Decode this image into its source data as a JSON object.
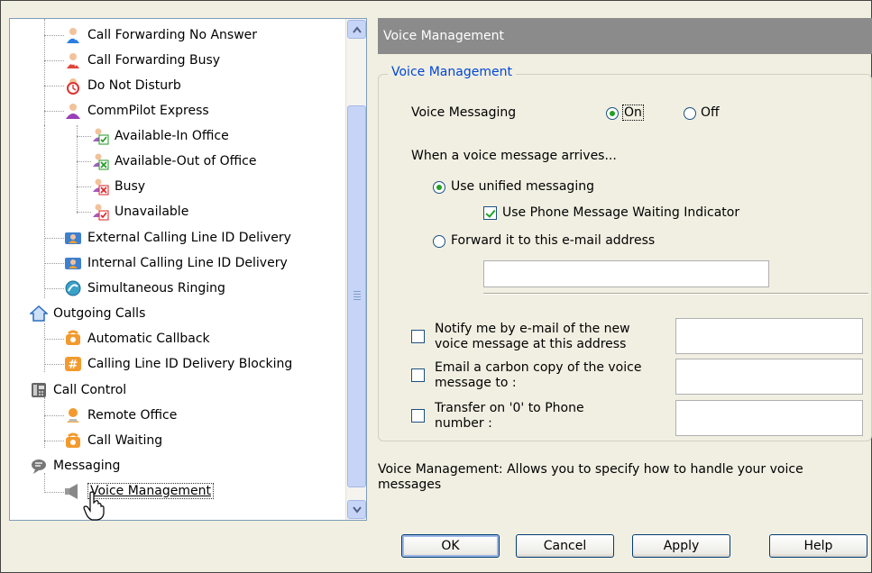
{
  "tree": {
    "items": [
      {
        "label": "Call Forwarding No Answer",
        "icon": "call-forwarding-no-answer-icon"
      },
      {
        "label": "Call Forwarding Busy",
        "icon": "call-forwarding-busy-icon"
      },
      {
        "label": "Do Not Disturb",
        "icon": "do-not-disturb-icon"
      },
      {
        "label": "CommPilot Express",
        "icon": "commpilot-express-icon"
      },
      {
        "label": "Available-In Office",
        "icon": "available-in-office-icon"
      },
      {
        "label": "Available-Out of Office",
        "icon": "available-out-of-office-icon"
      },
      {
        "label": "Busy",
        "icon": "busy-icon"
      },
      {
        "label": "Unavailable",
        "icon": "unavailable-icon"
      },
      {
        "label": "External Calling Line ID Delivery",
        "icon": "external-calling-line-id-icon"
      },
      {
        "label": "Internal Calling Line ID Delivery",
        "icon": "internal-calling-line-id-icon"
      },
      {
        "label": "Simultaneous Ringing",
        "icon": "simultaneous-ringing-icon"
      },
      {
        "label": "Outgoing Calls",
        "icon": "outgoing-calls-icon"
      },
      {
        "label": "Automatic Callback",
        "icon": "automatic-callback-icon"
      },
      {
        "label": "Calling Line ID Delivery Blocking",
        "icon": "calling-line-id-blocking-icon"
      },
      {
        "label": "Call Control",
        "icon": "call-control-icon"
      },
      {
        "label": "Remote Office",
        "icon": "remote-office-icon"
      },
      {
        "label": "Call Waiting",
        "icon": "call-waiting-icon"
      },
      {
        "label": "Messaging",
        "icon": "messaging-icon"
      },
      {
        "label": "Voice Management",
        "icon": "voice-management-icon",
        "selected": true
      }
    ]
  },
  "header": {
    "title": "Voice Management"
  },
  "group": {
    "title": "Voice Management"
  },
  "voice_messaging": {
    "label": "Voice Messaging",
    "on_label": "On",
    "off_label": "Off",
    "value": "On"
  },
  "arrival": {
    "label": "When a voice message arrives...",
    "unified_label": "Use unified messaging",
    "mwi_label": "Use Phone Message Waiting Indicator",
    "mwi_checked": true,
    "forward_label": "Forward it to this e-mail address",
    "forward_value": ""
  },
  "options": {
    "notify_line1": "Notify me by e-mail of the new",
    "notify_line2": "voice message at this address",
    "notify_value": "",
    "cc_line1": "Email a carbon copy of the voice",
    "cc_line2": "message to :",
    "cc_value": "",
    "transfer_line1": "Transfer on '0' to Phone",
    "transfer_line2": "number :",
    "transfer_value": ""
  },
  "description": "Voice Management: Allows you to specify how to handle your voice messages",
  "buttons": {
    "ok": "OK",
    "cancel": "Cancel",
    "apply": "Apply",
    "help": "Help"
  },
  "colors": {
    "header_bg": "#8b8b8b",
    "group_title": "#0046d5",
    "panel_bg": "#f1efe2"
  }
}
